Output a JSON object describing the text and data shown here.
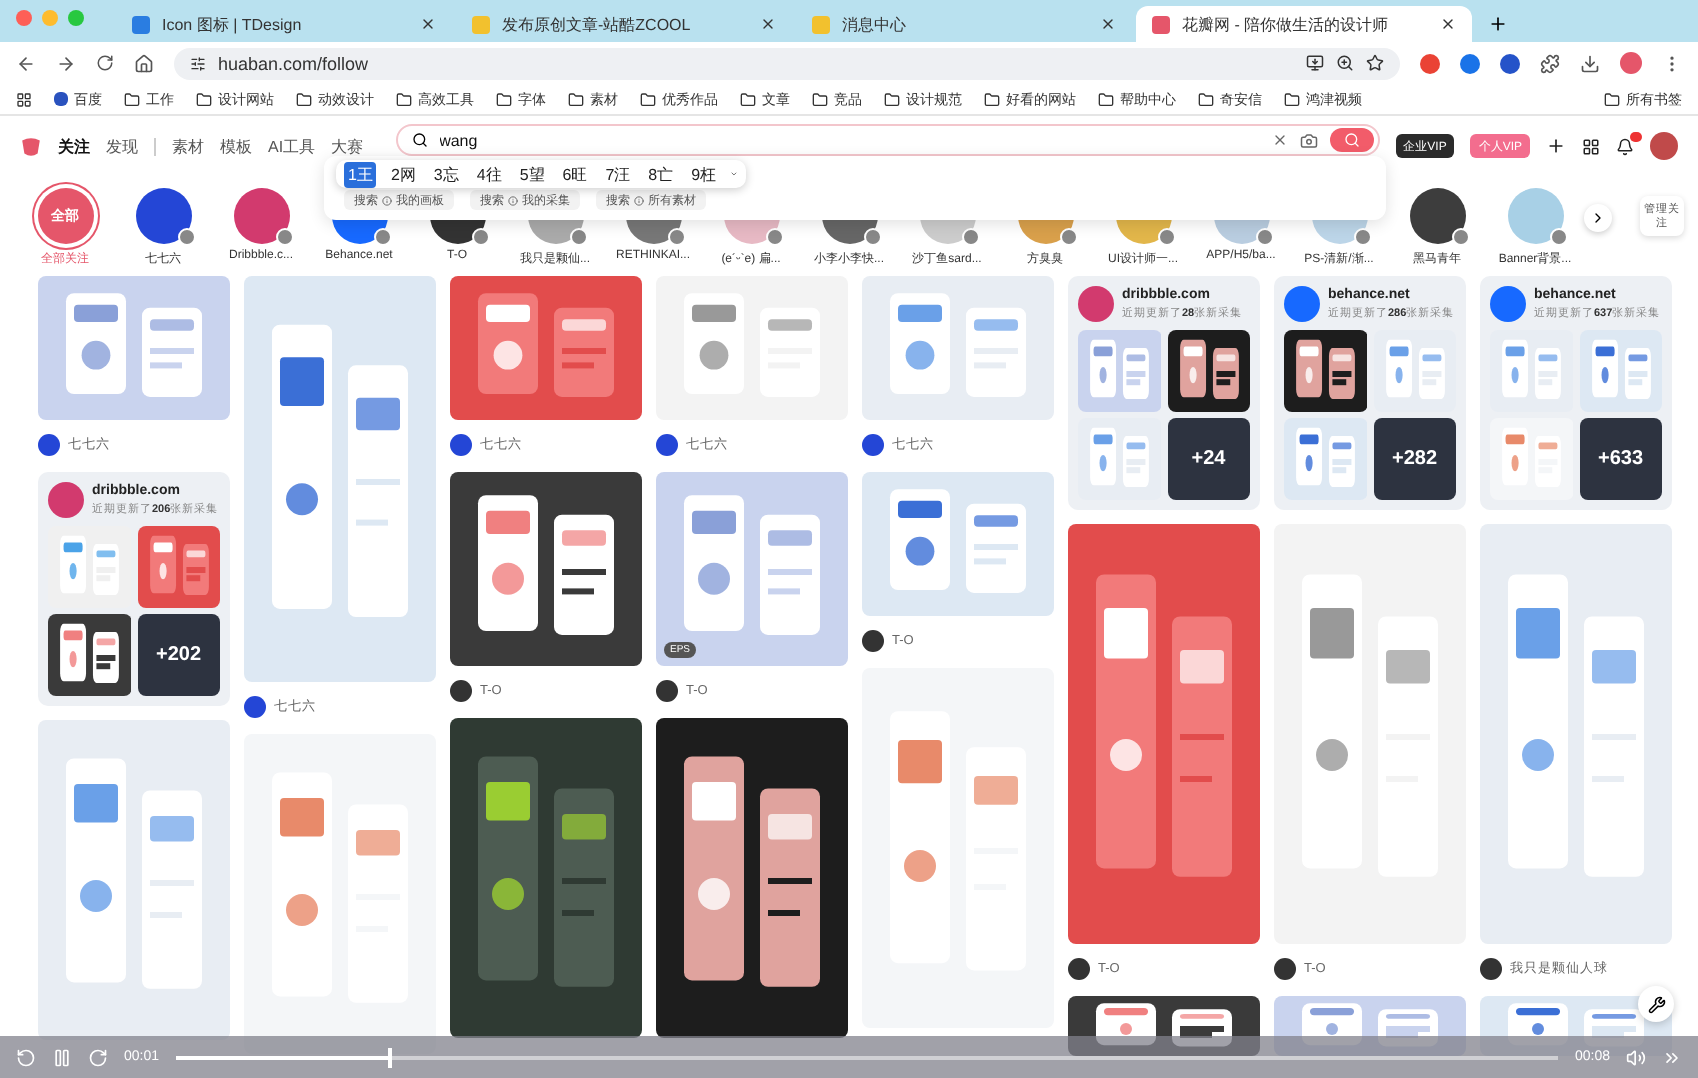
{
  "browser": {
    "tabs": [
      {
        "title": "Icon 图标 | TDesign",
        "selected": false
      },
      {
        "title": "发布原创文章-站酷ZCOOL",
        "selected": false
      },
      {
        "title": "消息中心",
        "selected": false
      },
      {
        "title": "花瓣网 - 陪你做生活的设计师",
        "selected": true
      }
    ],
    "url": "huaban.com/follow",
    "bookmarks": [
      "百度",
      "工作",
      "设计网站",
      "动效设计",
      "高效工具",
      "字体",
      "素材",
      "优秀作品",
      "文章",
      "竞品",
      "设计规范",
      "好看的网站",
      "帮助中心",
      "奇安信",
      "鸿津视频"
    ],
    "all_bookmarks": "所有书签"
  },
  "nav": {
    "items": [
      {
        "label": "关注",
        "selected": true
      },
      {
        "label": "发现",
        "selected": false
      },
      {
        "label": "素材",
        "selected": false
      },
      {
        "label": "模板",
        "selected": false
      },
      {
        "label": "AI工具",
        "selected": false
      },
      {
        "label": "大赛",
        "selected": false
      }
    ],
    "search": {
      "value": "wang"
    },
    "ime_candidates": [
      {
        "index": "1",
        "char": "王",
        "selected": true
      },
      {
        "index": "2",
        "char": "网",
        "selected": false
      },
      {
        "index": "3",
        "char": "忘",
        "selected": false
      },
      {
        "index": "4",
        "char": "往",
        "selected": false
      },
      {
        "index": "5",
        "char": "望",
        "selected": false
      },
      {
        "index": "6",
        "char": "旺",
        "selected": false
      },
      {
        "index": "7",
        "char": "汪",
        "selected": false
      },
      {
        "index": "8",
        "char": "亡",
        "selected": false
      },
      {
        "index": "9",
        "char": "枉",
        "selected": false
      }
    ],
    "search_scopes": [
      {
        "verb": "搜索",
        "label": "我的画板"
      },
      {
        "verb": "搜索",
        "label": "我的采集"
      },
      {
        "verb": "搜索",
        "label": "所有素材"
      }
    ],
    "enterprise_vip": "企业VIP",
    "personal_vip": "个人VIP"
  },
  "follows": [
    {
      "name": "全部关注",
      "badge": "全部",
      "selected": true
    },
    {
      "name": "七七六",
      "selected": false
    },
    {
      "name": "Dribbble.c...",
      "selected": false
    },
    {
      "name": "Behance.net",
      "selected": false
    },
    {
      "name": "T-O",
      "selected": false
    },
    {
      "name": "我只是颗仙...",
      "selected": false
    },
    {
      "name": "RETHINKAI...",
      "selected": false
    },
    {
      "name": "(e´ᵕ`e) 扁...",
      "selected": false
    },
    {
      "name": "小李小李快...",
      "selected": false
    },
    {
      "name": "沙丁鱼sard...",
      "selected": false
    },
    {
      "name": "方臭臭",
      "selected": false
    },
    {
      "name": "UI设计师一...",
      "selected": false
    },
    {
      "name": "APP/H5/ba...",
      "selected": false
    },
    {
      "name": "PS-清新/渐...",
      "selected": false
    },
    {
      "name": "黑马青年",
      "selected": false
    },
    {
      "name": "Banner背景...",
      "selected": false
    }
  ],
  "manage": "管理关注",
  "columns": [
    [
      {
        "kind": "pin",
        "author": "七七六"
      },
      {
        "kind": "collection",
        "site": "dribbble.com",
        "note": "近期更新了**206**张新采集",
        "more": "+202"
      },
      {
        "kind": "pin"
      }
    ],
    [
      {
        "kind": "pin",
        "author": "七七六"
      },
      {
        "kind": "pin"
      }
    ],
    [
      {
        "kind": "pin",
        "author": "七七六"
      },
      {
        "kind": "pin",
        "author": "T-O"
      },
      {
        "kind": "pin"
      }
    ],
    [
      {
        "kind": "pin",
        "author": "七七六"
      },
      {
        "kind": "pin",
        "author": "T-O",
        "badge": "EPS"
      },
      {
        "kind": "pin"
      }
    ],
    [
      {
        "kind": "pin",
        "author": "七七六"
      },
      {
        "kind": "pin",
        "author": "T-O"
      },
      {
        "kind": "pin"
      }
    ],
    [
      {
        "kind": "collection",
        "site": "dribbble.com",
        "note": "近期更新了**28**张新采集",
        "more": "+24"
      },
      {
        "kind": "pin",
        "author": "T-O"
      },
      {
        "kind": "pin"
      }
    ],
    [
      {
        "kind": "collection",
        "site": "behance.net",
        "note": "近期更新了**286**张新采集",
        "more": "+282"
      },
      {
        "kind": "pin",
        "author": "T-O"
      },
      {
        "kind": "pin"
      }
    ],
    [
      {
        "kind": "collection",
        "site": "behance.net",
        "note": "近期更新了**637**张新采集",
        "more": "+633"
      },
      {
        "kind": "pin",
        "author": "我只是颗仙人球"
      },
      {
        "kind": "pin"
      }
    ]
  ],
  "player": {
    "elapsed": "00:01",
    "total": "00:08",
    "level": 0.155
  }
}
